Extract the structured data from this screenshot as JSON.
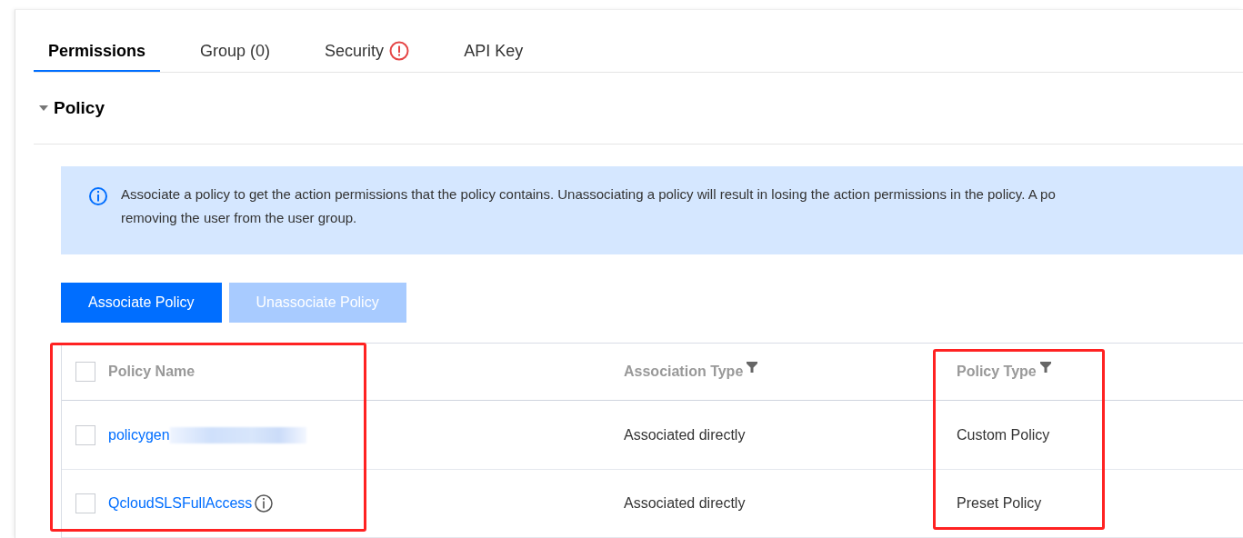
{
  "tabs": [
    {
      "label": "Permissions",
      "selected": true,
      "alert": false
    },
    {
      "label": "Group (0)",
      "selected": false,
      "alert": false
    },
    {
      "label": "Security",
      "selected": false,
      "alert": true
    },
    {
      "label": "API Key",
      "selected": false,
      "alert": false
    }
  ],
  "section": {
    "title": "Policy",
    "expanded": true
  },
  "notice": {
    "lines": [
      "Associate a policy to get the action permissions that the policy contains. Unassociating a policy will result in losing the action permissions in the policy. A po",
      "removing the user from the user group."
    ]
  },
  "buttons": [
    {
      "label": "Associate Policy",
      "disabled": false
    },
    {
      "label": "Unassociate Policy",
      "disabled": true
    }
  ],
  "table": {
    "all_checked": false,
    "columns": [
      {
        "label": "Policy Name",
        "filter": false,
        "highlighted": true
      },
      {
        "label": "Association Type",
        "filter": true,
        "highlighted": false
      },
      {
        "label": "Policy Type",
        "filter": true,
        "highlighted": true
      }
    ],
    "rows": [
      {
        "checked": false,
        "name": "policygen",
        "redacted": true,
        "info": false,
        "association": "Associated directly",
        "type": "Custom Policy"
      },
      {
        "checked": false,
        "name": "QcloudSLSFullAccess",
        "redacted": false,
        "info": true,
        "association": "Associated directly",
        "type": "Preset Policy"
      }
    ]
  }
}
